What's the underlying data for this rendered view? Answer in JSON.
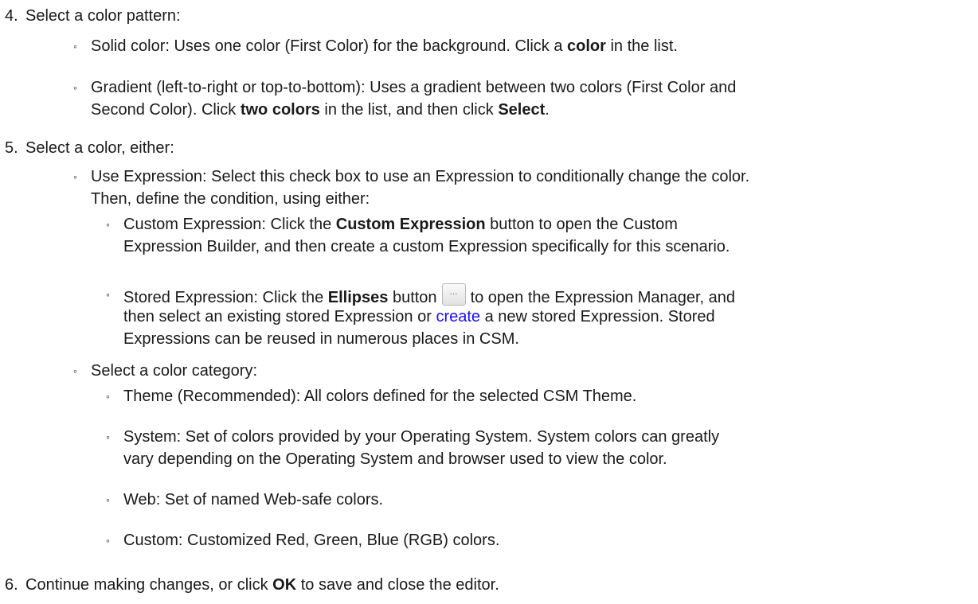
{
  "step4": {
    "number": "4.",
    "text": "Select a color pattern:",
    "items": [
      {
        "pre": "Solid color: Uses one color (First Color) for the background. Click a ",
        "bold": "color",
        "post": " in the list."
      },
      {
        "line1": "Gradient (left-to-right or top-to-bottom): Uses a gradient between two colors (First Color and",
        "pre": "Second Color). Click ",
        "bold1": "two colors",
        "mid": " in the list, and then click ",
        "bold2": "Select",
        "post": "."
      }
    ]
  },
  "step5": {
    "number": "5.",
    "text": "Select a color, either:",
    "use_expression": {
      "line1": "Use Expression: Select this check box to use an Expression to conditionally change the color.",
      "line2": "Then, define the condition, using either:",
      "custom": {
        "pre": "Custom Expression: Click the ",
        "bold": "Custom Expression",
        "post": " button to open the Custom",
        "line2": "Expression Builder, and then create a custom Expression specifically for this scenario."
      },
      "stored": {
        "pre": "Stored Expression: Click the ",
        "bold": "Ellipses",
        "mid": " button",
        "button_glyph": "...",
        "post": "to open the Expression Manager, and",
        "line2_pre": "then select an existing stored Expression or ",
        "link": "create",
        "line2_post": " a new stored Expression. Stored",
        "line3": "Expressions can be reused in numerous places in CSM."
      }
    },
    "category": {
      "text": "Select a color category:",
      "items": [
        {
          "line1": "Theme (Recommended): All colors defined for the selected CSM Theme."
        },
        {
          "line1": "System: Set of colors provided by your Operating System. System colors can greatly",
          "line2": "vary depending on the Operating System and browser used to view the color."
        },
        {
          "line1": "Web: Set of named Web-safe colors."
        },
        {
          "line1": "Custom: Customized Red, Green, Blue (RGB) colors."
        }
      ]
    }
  },
  "step6": {
    "number": "6.",
    "pre": "Continue making changes, or click ",
    "bold": "OK",
    "post": " to save and close the editor."
  },
  "colors": {
    "text": "#1a1a1a",
    "link": "#1a0dff",
    "background": "#ffffff"
  }
}
